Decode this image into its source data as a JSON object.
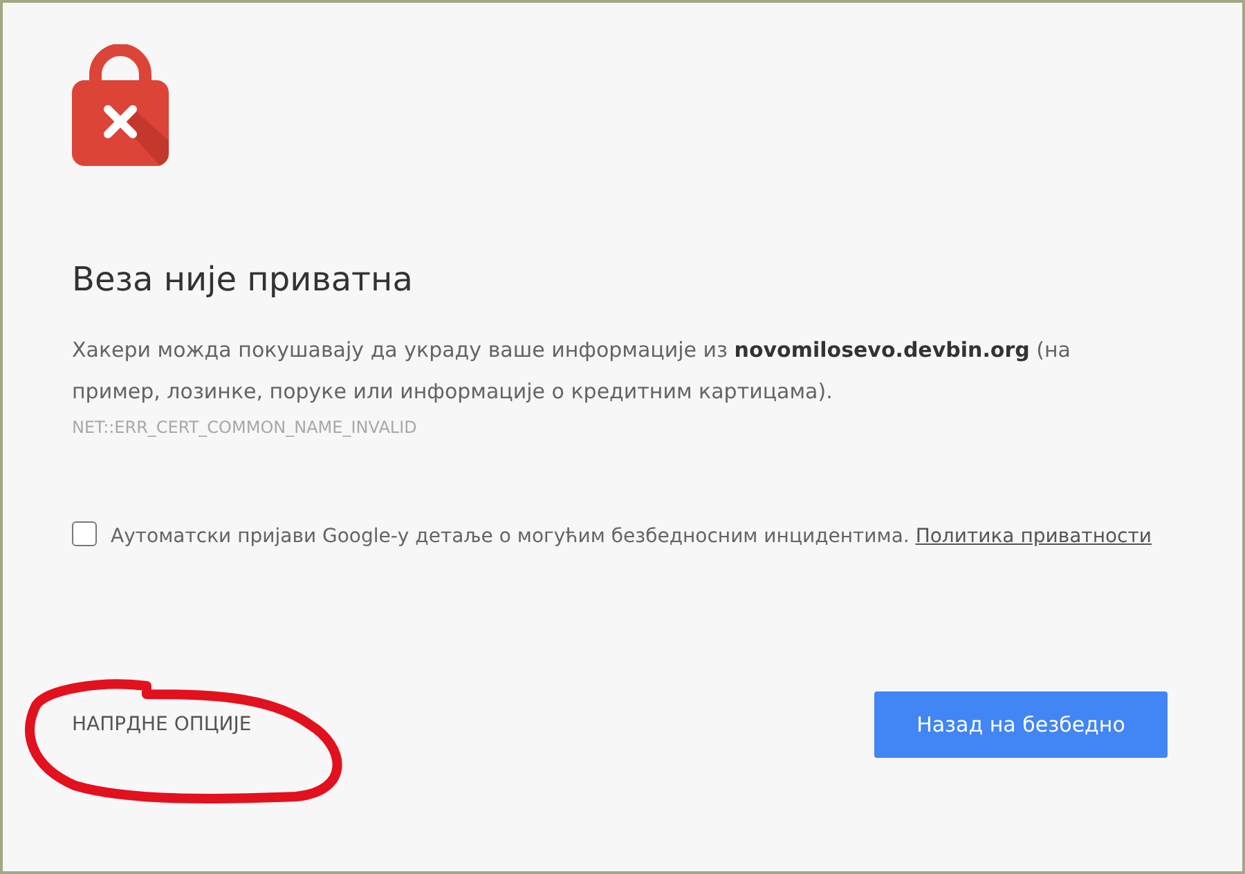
{
  "heading": "Веза није приватна",
  "message": "Хакери можда покушавају да украду ваше информације из **novomilosevo.devbin.org** (на пример, лозинке, поруке или информације о кредитним картицама).",
  "error_code": "NET::ERR_CERT_COMMON_NAME_INVALID",
  "report": {
    "checked": false,
    "label": "Аутоматски пријави Google-у детаље о могућим безбедносним инцидентима.",
    "link": "Политика приватности"
  },
  "buttons": [
    {
      "kind": "link",
      "label": "НАПРДНЕ ОПЦИЈЕ"
    },
    {
      "kind": "primary",
      "label": "Назад на безбедно"
    }
  ]
}
